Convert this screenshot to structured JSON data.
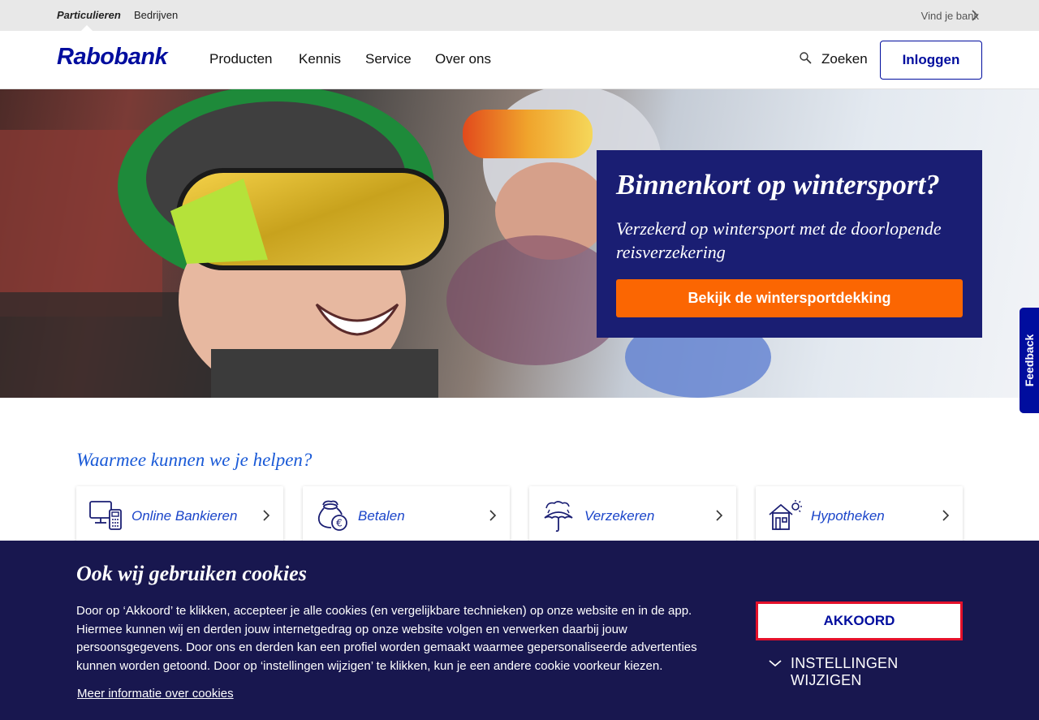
{
  "topbar": {
    "segments": [
      {
        "label": "Particulieren",
        "active": true
      },
      {
        "label": "Bedrijven",
        "active": false
      }
    ],
    "find_bank": "Vind je bank"
  },
  "header": {
    "logo": "Rabobank",
    "nav": [
      "Producten",
      "Kennis",
      "Service",
      "Over ons"
    ],
    "search_label": "Zoeken",
    "login_label": "Inloggen"
  },
  "hero": {
    "title": "Binnenkort op wintersport?",
    "subtitle": "Verzekerd op wintersport met de doorlopende reisverzekering",
    "cta": "Bekijk de wintersportdekking"
  },
  "feedback": "Feedback",
  "help": {
    "title": "Waarmee kunnen we je helpen?",
    "cards": [
      {
        "label": "Online Bankieren",
        "icon": "online-banking-icon"
      },
      {
        "label": "Betalen",
        "icon": "money-bag-euro-icon"
      },
      {
        "label": "Verzekeren",
        "icon": "umbrella-rain-icon"
      },
      {
        "label": "Hypotheken",
        "icon": "house-sun-icon"
      }
    ]
  },
  "cookie": {
    "title": "Ook wij gebruiken cookies",
    "text": "Door op ‘Akkoord’ te klikken, accepteer je alle cookies (en vergelijkbare technieken) op onze website en in de app. Hiermee kunnen wij en derden jouw internetgedrag op onze website volgen en verwerken daarbij jouw persoonsgegevens. Door ons en derden kan een profiel worden gemaakt waarmee gepersonaliseerde advertenties kunnen worden getoond. Door op ‘instellingen wijzigen’ te klikken, kun je een andere cookie voorkeur kiezen.",
    "more_info": "Meer informatie over cookies",
    "accept": "AKKOORD",
    "settings": "INSTELLINGEN WIJZIGEN"
  },
  "colors": {
    "brand_blue": "#000d9e",
    "hero_box": "#1a1e73",
    "cta_orange": "#fb6602",
    "cookie_bg": "#18174f",
    "accept_border": "#e4102a",
    "link_blue": "#1a5ad7"
  }
}
